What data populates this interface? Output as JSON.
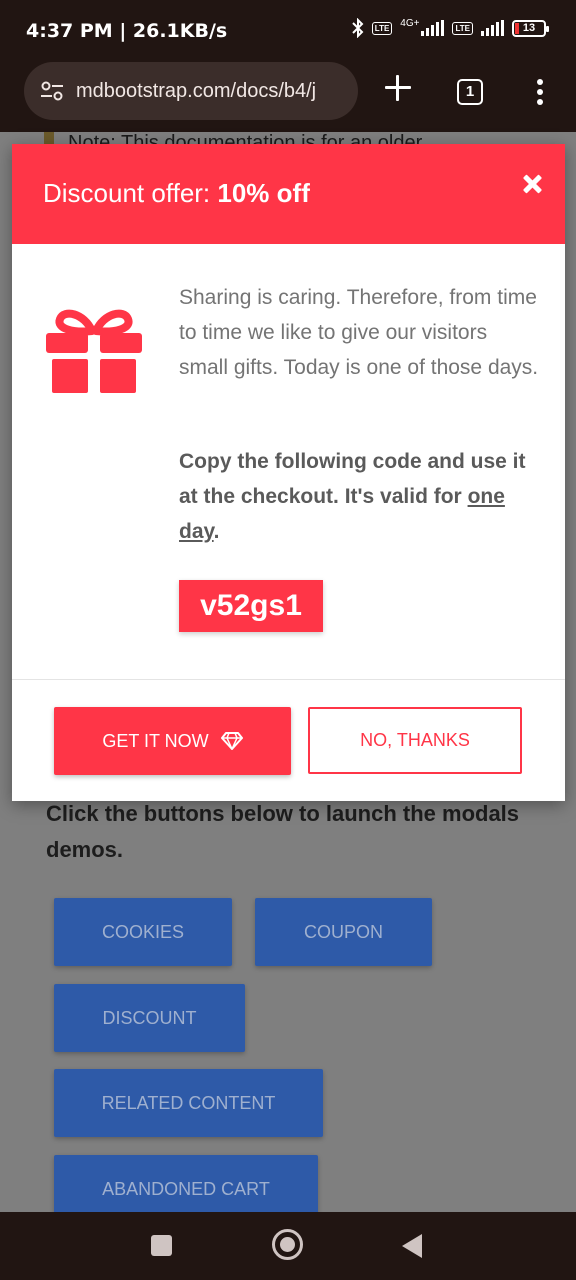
{
  "status_bar": {
    "time": "4:37 PM | 26.1KB/s",
    "network": "4G+",
    "lte_badge": "LTE",
    "battery": "13"
  },
  "browser": {
    "url": "mdbootstrap.com/docs/b4/j",
    "tab_count": "1"
  },
  "page": {
    "note_text": "Note: This documentation is for an older",
    "instruction": "Click the buttons below to launch the modals demos.",
    "demo_buttons": [
      "COOKIES",
      "COUPON",
      "DISCOUNT",
      "RELATED CONTENT",
      "ABANDONED CART"
    ]
  },
  "modal": {
    "title_prefix": "Discount offer: ",
    "title_bold": "10% off",
    "body": "Sharing is caring. Therefore, from time to time we like to give our visitors small gifts. Today is one of those days.",
    "copy_prefix": "Copy the following code and use it at the checkout. It's valid for ",
    "copy_underlined": "one day",
    "copy_suffix": ".",
    "code": "v52gs1",
    "get_button": "GET IT NOW",
    "no_button": "NO, THANKS",
    "accent_color": "#ff3547"
  },
  "icons": {
    "gift": "gift-icon",
    "diamond": "diamond-icon",
    "close": "close-icon"
  }
}
